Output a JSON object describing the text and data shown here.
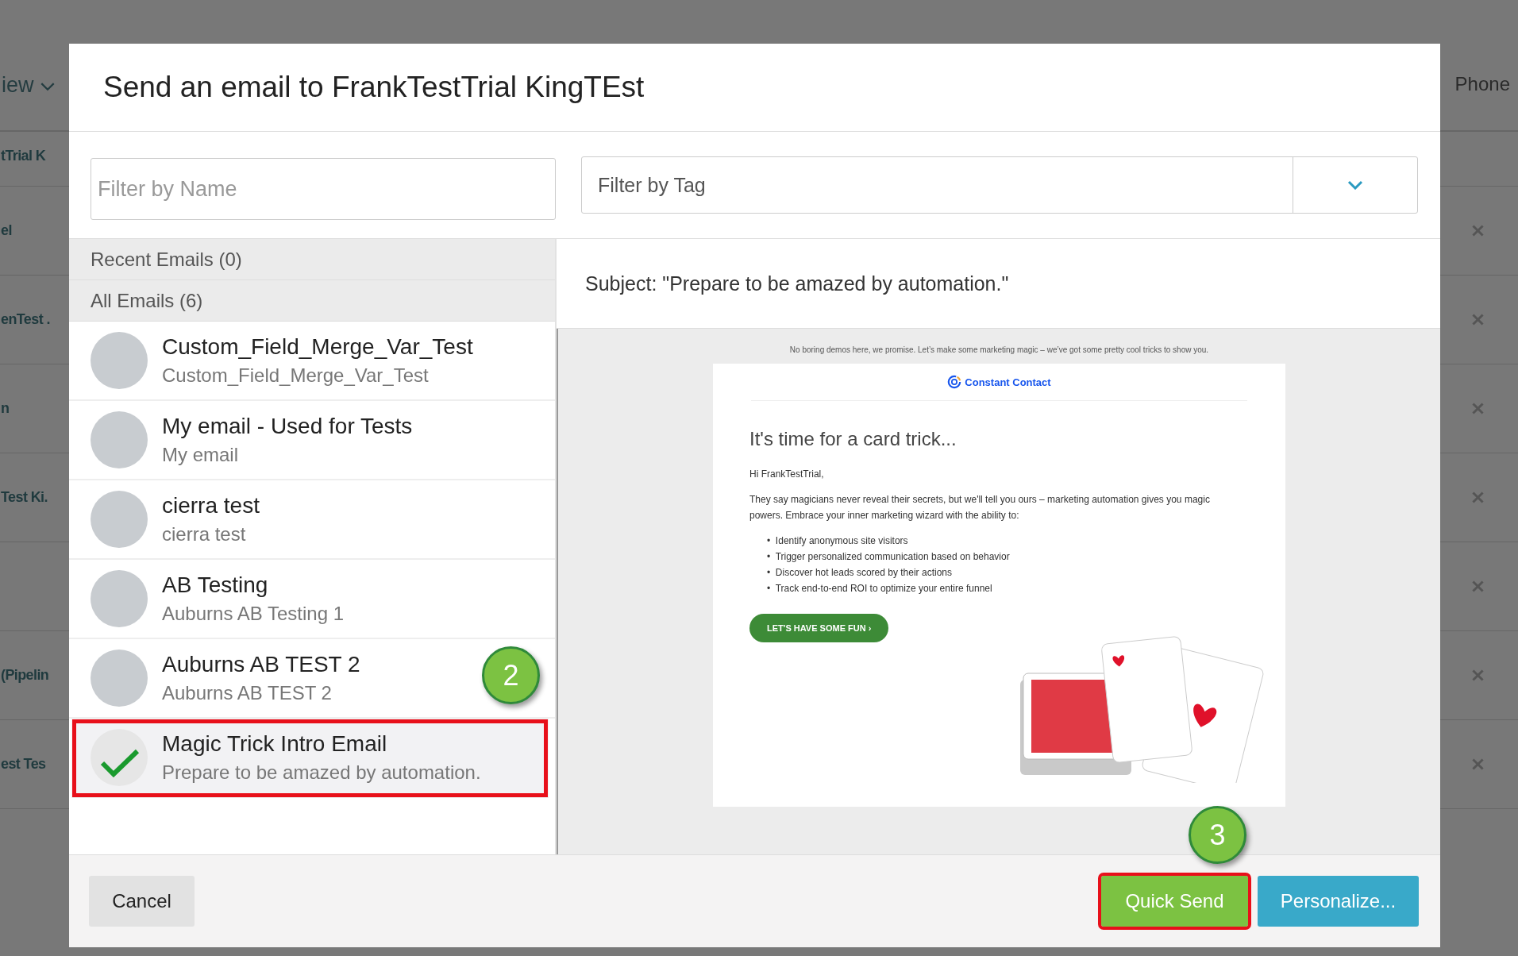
{
  "background": {
    "header_left": "iew",
    "header_right": "Phone",
    "rows": [
      {
        "name": "tTrial K",
        "removable": false
      },
      {
        "name": "el",
        "removable": true
      },
      {
        "name": "enTest .",
        "removable": true
      },
      {
        "name": "n",
        "removable": true
      },
      {
        "name": "Test Ki.",
        "removable": true
      },
      {
        "removable": true
      },
      {
        "name": "(Pipelin",
        "removable": true
      },
      {
        "name": "est Tes",
        "removable": true
      }
    ]
  },
  "modal": {
    "title": "Send an email to FrankTestTrial KingTEst",
    "filters": {
      "name_placeholder": "Filter by Name",
      "tag_placeholder": "Filter by Tag"
    },
    "sections": [
      {
        "label": "Recent Emails (0)"
      },
      {
        "label": "All Emails (6)"
      }
    ],
    "emails": [
      {
        "title": "Custom_Field_Merge_Var_Test",
        "subtitle": "Custom_Field_Merge_Var_Test",
        "selected": false
      },
      {
        "title": "My email - Used for Tests",
        "subtitle": "My email",
        "selected": false
      },
      {
        "title": "cierra test",
        "subtitle": "cierra test",
        "selected": false
      },
      {
        "title": "AB Testing",
        "subtitle": "Auburns AB Testing 1",
        "selected": false
      },
      {
        "title": "Auburns AB TEST 2",
        "subtitle": "Auburns AB TEST 2",
        "selected": false
      },
      {
        "title": "Magic Trick Intro Email",
        "subtitle": "Prepare to be amazed by automation.",
        "selected": true
      }
    ],
    "preview": {
      "subject": "Subject: \"Prepare to be amazed by automation.\"",
      "preheader": "No boring demos here, we promise. Let’s make some marketing magic – we’ve got some pretty cool tricks to show you.",
      "brand": "Constant Contact",
      "heading": "It's time for a card trick...",
      "greeting": "Hi FrankTestTrial,",
      "body": "They say magicians never reveal their secrets, but we'll tell you ours – marketing automation gives you magic powers. Embrace your inner marketing wizard with the ability to:",
      "bullets": [
        "•  Identify anonymous site visitors",
        "•  Trigger personalized communication based on behavior",
        "•  Discover hot leads scored by their actions",
        "•  Track end-to-end ROI to optimize your entire funnel"
      ],
      "cta": "LET'S HAVE SOME FUN ›"
    },
    "buttons": [
      {
        "kind": "cancel",
        "label": "Cancel",
        "highlighted": false
      },
      {
        "kind": "primary",
        "label": "Quick Send",
        "highlighted": true
      },
      {
        "kind": "secondary",
        "label": "Personalize...",
        "highlighted": false
      }
    ],
    "callouts": [
      {
        "label": "2"
      },
      {
        "label": "3"
      }
    ]
  }
}
